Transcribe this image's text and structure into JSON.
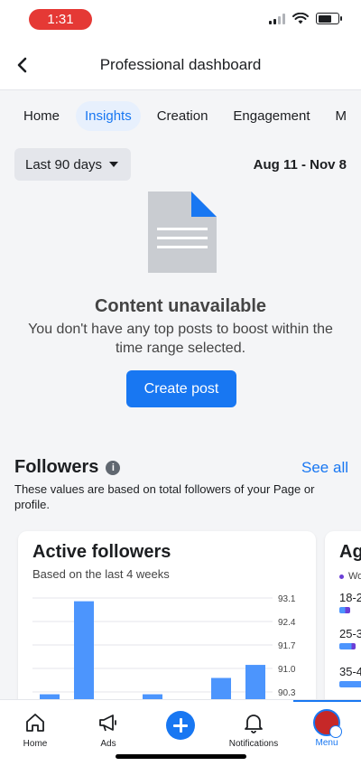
{
  "status": {
    "time": "1:31"
  },
  "header": {
    "title": "Professional dashboard"
  },
  "tabs": [
    {
      "label": "Home"
    },
    {
      "label": "Insights"
    },
    {
      "label": "Creation"
    },
    {
      "label": "Engagement"
    },
    {
      "label": "M"
    }
  ],
  "filter": {
    "label": "Last 90 days",
    "range": "Aug 11 - Nov 8"
  },
  "empty_state": {
    "title": "Content unavailable",
    "message": "You don't have any top posts to boost within the time range selected.",
    "button": "Create post"
  },
  "followers": {
    "title": "Followers",
    "see_all": "See all",
    "description": "These values are based on total followers of your Page or profile."
  },
  "active_followers": {
    "title": "Active followers",
    "subtitle": "Based on the last 4 weeks"
  },
  "age_card": {
    "title": "Ag",
    "legend": "Wo",
    "ranges": [
      "18-2",
      "25-3",
      "35-4"
    ]
  },
  "chart_data": {
    "type": "bar",
    "y_ticks": [
      "93.1",
      "92.4",
      "91.7",
      "91.0",
      "90.3"
    ],
    "ylim": [
      90.0,
      93.1
    ],
    "values": [
      90.15,
      93.0,
      90.0,
      90.15,
      90.0,
      90.65,
      91.05
    ],
    "bar_color": "#4c95fd"
  },
  "bottom_nav": [
    {
      "label": "Home",
      "icon": "home-icon"
    },
    {
      "label": "Ads",
      "icon": "megaphone-icon"
    },
    {
      "label": "",
      "icon": "plus-icon"
    },
    {
      "label": "Notifications",
      "icon": "bell-icon"
    },
    {
      "label": "Menu",
      "icon": "avatar"
    }
  ],
  "colors": {
    "accent": "#1877f2",
    "status_pill": "#e53935"
  }
}
